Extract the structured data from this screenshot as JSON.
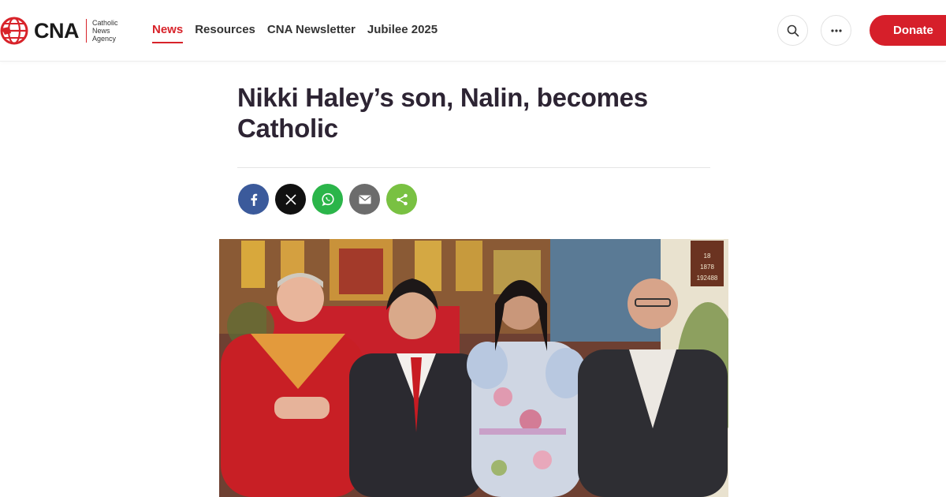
{
  "header": {
    "logo": {
      "wordmark": "CNA",
      "subtitle_lines": [
        "Catholic",
        "News",
        "Agency"
      ]
    },
    "nav": [
      {
        "label": "News",
        "active": true
      },
      {
        "label": "Resources",
        "active": false
      },
      {
        "label": "CNA Newsletter",
        "active": false
      },
      {
        "label": "Jubilee 2025",
        "active": false
      }
    ],
    "search_icon": "search-icon",
    "more_icon": "more-horizontal-icon",
    "donate_label": "Donate"
  },
  "article": {
    "headline": "Nikki Haley’s son, Nalin, becomes Catholic",
    "share_buttons": [
      {
        "network": "facebook",
        "icon": "facebook-icon",
        "color": "#3b5a9b"
      },
      {
        "network": "x",
        "icon": "x-icon",
        "color": "#111111"
      },
      {
        "network": "whatsapp",
        "icon": "whatsapp-icon",
        "color": "#2bb54a"
      },
      {
        "network": "email",
        "icon": "email-icon",
        "color": "#6c6c6c"
      },
      {
        "network": "share",
        "icon": "share-icon",
        "color": "#79c142"
      }
    ],
    "hero_sign_text": [
      "18",
      "1878",
      "192488"
    ]
  },
  "colors": {
    "brand_red": "#d61f2a",
    "text_dark": "#2d2433"
  }
}
